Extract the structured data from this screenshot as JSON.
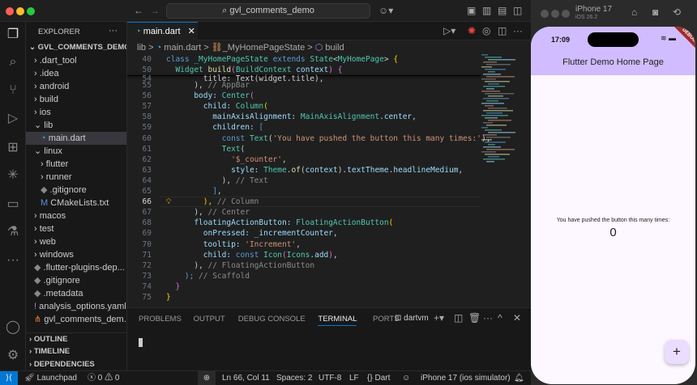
{
  "titlebar": {
    "search": "gvl_comments_demo"
  },
  "sidebar": {
    "title": "EXPLORER",
    "more": "···",
    "root": "GVL_COMMENTS_DEMO",
    "items": [
      {
        "label": ".dart_tool",
        "indent": 1,
        "type": "folder-closed"
      },
      {
        "label": ".idea",
        "indent": 1,
        "type": "folder-closed"
      },
      {
        "label": "android",
        "indent": 1,
        "type": "folder-closed"
      },
      {
        "label": "build",
        "indent": 1,
        "type": "folder-closed"
      },
      {
        "label": "ios",
        "indent": 1,
        "type": "folder-closed"
      },
      {
        "label": "lib",
        "indent": 1,
        "type": "folder-open"
      },
      {
        "label": "main.dart",
        "indent": 2,
        "type": "dart",
        "selected": true
      },
      {
        "label": "linux",
        "indent": 1,
        "type": "folder-open"
      },
      {
        "label": "flutter",
        "indent": 2,
        "type": "folder-closed"
      },
      {
        "label": "runner",
        "indent": 2,
        "type": "folder-closed"
      },
      {
        "label": ".gitignore",
        "indent": 2,
        "type": "file"
      },
      {
        "label": "CMakeLists.txt",
        "indent": 2,
        "type": "cmake"
      },
      {
        "label": "macos",
        "indent": 1,
        "type": "folder-closed"
      },
      {
        "label": "test",
        "indent": 1,
        "type": "folder-closed"
      },
      {
        "label": "web",
        "indent": 1,
        "type": "folder-closed"
      },
      {
        "label": "windows",
        "indent": 1,
        "type": "folder-closed"
      },
      {
        "label": ".flutter-plugins-dep...",
        "indent": 1,
        "type": "file"
      },
      {
        "label": ".gitignore",
        "indent": 1,
        "type": "file"
      },
      {
        "label": ".metadata",
        "indent": 1,
        "type": "file"
      },
      {
        "label": "analysis_options.yaml",
        "indent": 1,
        "type": "yaml"
      },
      {
        "label": "gvl_comments_dem...",
        "indent": 1,
        "type": "xml"
      }
    ],
    "sections": [
      "OUTLINE",
      "TIMELINE",
      "DEPENDENCIES"
    ]
  },
  "editor": {
    "tab": "main.dart",
    "breadcrumb": [
      "lib",
      ">",
      "main.dart",
      ">",
      "_MyHomePageState",
      ">",
      "build"
    ],
    "lines": [
      {
        "n": "40",
        "t": [
          [
            "class ",
            "k"
          ],
          [
            "_MyHomePageState ",
            "c"
          ],
          [
            "extends ",
            "k"
          ],
          [
            "State",
            "c"
          ],
          [
            "<",
            "x"
          ],
          [
            "MyHomePage",
            "c"
          ],
          [
            "> ",
            "x"
          ],
          [
            "{",
            "y"
          ]
        ]
      },
      {
        "n": "50",
        "t": [
          [
            "  Widget ",
            "c"
          ],
          [
            "build",
            "f"
          ],
          [
            "(",
            "m"
          ],
          [
            "BuildContext ",
            "c"
          ],
          [
            "context",
            "p"
          ],
          [
            ") ",
            "m"
          ],
          [
            "{",
            "m"
          ]
        ]
      },
      {
        "n": "54",
        "t": [
          [
            "        title: Text(widget.title),",
            "x"
          ]
        ]
      },
      {
        "n": "55",
        "t": [
          [
            "      ), ",
            "x"
          ],
          [
            "// AppBar",
            "cm"
          ]
        ]
      },
      {
        "n": "56",
        "t": [
          [
            "      body: ",
            "p"
          ],
          [
            "Center",
            "c"
          ],
          [
            "(",
            "m"
          ]
        ]
      },
      {
        "n": "57",
        "t": [
          [
            "        child: ",
            "p"
          ],
          [
            "Column",
            "c"
          ],
          [
            "(",
            "y"
          ]
        ]
      },
      {
        "n": "58",
        "t": [
          [
            "          mainAxisAlignment: ",
            "p"
          ],
          [
            "MainAxisAlignment",
            "c"
          ],
          [
            ".center",
            "p"
          ],
          [
            ",",
            "x"
          ]
        ]
      },
      {
        "n": "59",
        "t": [
          [
            "          children: ",
            "p"
          ],
          [
            "[",
            "k"
          ]
        ]
      },
      {
        "n": "60",
        "t": [
          [
            "            const ",
            "k"
          ],
          [
            "Text",
            "c"
          ],
          [
            "(",
            "x"
          ],
          [
            "'You have pushed the button this many times:'",
            "s"
          ],
          [
            "),",
            "x"
          ]
        ]
      },
      {
        "n": "61",
        "t": [
          [
            "            Text",
            "c"
          ],
          [
            "(",
            "x"
          ]
        ]
      },
      {
        "n": "62",
        "t": [
          [
            "              '$_counter'",
            "s"
          ],
          [
            ",",
            "x"
          ]
        ]
      },
      {
        "n": "63",
        "t": [
          [
            "              style: ",
            "p"
          ],
          [
            "Theme",
            "c"
          ],
          [
            ".",
            "x"
          ],
          [
            "of",
            "f"
          ],
          [
            "(",
            "x"
          ],
          [
            "context",
            "p"
          ],
          [
            ").",
            "x"
          ],
          [
            "textTheme",
            "p"
          ],
          [
            ".",
            "x"
          ],
          [
            "headlineMedium",
            "p"
          ],
          [
            ",",
            "x"
          ]
        ]
      },
      {
        "n": "64",
        "t": [
          [
            "            ), ",
            "x"
          ],
          [
            "// Text",
            "cm"
          ]
        ]
      },
      {
        "n": "65",
        "t": [
          [
            "          ]",
            "k"
          ],
          [
            ",",
            "x"
          ]
        ]
      },
      {
        "n": "66",
        "t": [
          [
            "        ), ",
            "y"
          ],
          [
            "// Column",
            "cm"
          ]
        ],
        "current": true
      },
      {
        "n": "67",
        "t": [
          [
            "      ), ",
            "x"
          ],
          [
            "// Center",
            "cm"
          ]
        ]
      },
      {
        "n": "68",
        "t": [
          [
            "      floatingActionButton: ",
            "p"
          ],
          [
            "FloatingActionButton",
            "c"
          ],
          [
            "(",
            "y"
          ]
        ]
      },
      {
        "n": "69",
        "t": [
          [
            "        onPressed: ",
            "p"
          ],
          [
            "_incrementCounter",
            "p"
          ],
          [
            ",",
            "x"
          ]
        ]
      },
      {
        "n": "70",
        "t": [
          [
            "        tooltip: ",
            "p"
          ],
          [
            "'Increment'",
            "s"
          ],
          [
            ",",
            "x"
          ]
        ]
      },
      {
        "n": "71",
        "t": [
          [
            "        child: ",
            "p"
          ],
          [
            "const ",
            "k"
          ],
          [
            "Icon",
            "c"
          ],
          [
            "(",
            "m"
          ],
          [
            "Icons",
            "c"
          ],
          [
            ".",
            "x"
          ],
          [
            "add",
            "p"
          ],
          [
            ")",
            "m"
          ],
          [
            ",",
            "x"
          ]
        ]
      },
      {
        "n": "72",
        "t": [
          [
            "      ), ",
            "x"
          ],
          [
            "// FloatingActionButton",
            "cm"
          ]
        ]
      },
      {
        "n": "73",
        "t": [
          [
            "    ); ",
            "k"
          ],
          [
            "// Scaffold",
            "cm"
          ]
        ]
      },
      {
        "n": "74",
        "t": [
          [
            "  }",
            "m"
          ]
        ]
      },
      {
        "n": "75",
        "t": [
          [
            "}",
            "y"
          ]
        ]
      }
    ]
  },
  "panel": {
    "tabs": [
      "PROBLEMS",
      "OUTPUT",
      "DEBUG CONSOLE",
      "TERMINAL",
      "PORTS"
    ],
    "active": "TERMINAL",
    "terminal_name": "dartvm"
  },
  "status": {
    "launchpad": "Launchpad",
    "errors": "0",
    "warnings": "0",
    "position": "Ln 66, Col 11",
    "spaces": "Spaces: 2",
    "encoding": "UTF-8",
    "eol": "LF",
    "language": "Dart",
    "device": "iPhone 17 (ios simulator)"
  },
  "simulator": {
    "device": "iPhone 17",
    "os": "iOS 26.2",
    "time": "17:09",
    "debug_banner": "DEBUG",
    "app_title": "Flutter Demo Home Page",
    "message": "You have pushed the button this many times:",
    "counter": "0",
    "fab": "+"
  }
}
